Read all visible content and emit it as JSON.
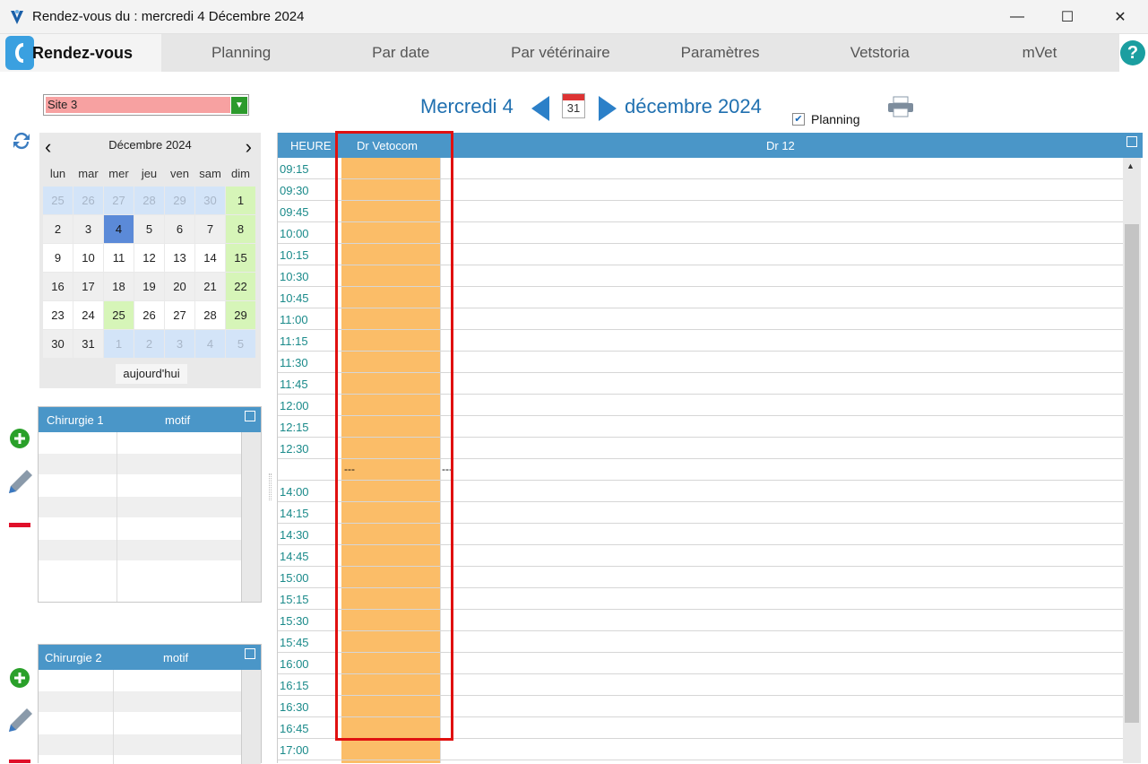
{
  "window": {
    "title": "Rendez-vous du : mercredi 4 Décembre 2024",
    "min": "—",
    "max": "☐",
    "close": "✕"
  },
  "tabs": {
    "active": "Rendez-vous",
    "items": [
      "Planning",
      "Par date",
      "Par vétérinaire",
      "Paramètres",
      "Vetstoria",
      "mVet"
    ]
  },
  "help": "?",
  "site": {
    "value": "Site 3"
  },
  "calendar": {
    "month": "Décembre 2024",
    "weekdays": [
      "lun",
      "mar",
      "mer",
      "jeu",
      "ven",
      "sam",
      "dim"
    ],
    "weeks": [
      [
        "25",
        "26",
        "27",
        "28",
        "29",
        "30",
        "1"
      ],
      [
        "2",
        "3",
        "4",
        "5",
        "6",
        "7",
        "8"
      ],
      [
        "9",
        "10",
        "11",
        "12",
        "13",
        "14",
        "15"
      ],
      [
        "16",
        "17",
        "18",
        "19",
        "20",
        "21",
        "22"
      ],
      [
        "23",
        "24",
        "25",
        "26",
        "27",
        "28",
        "29"
      ],
      [
        "30",
        "31",
        "1",
        "2",
        "3",
        "4",
        "5"
      ]
    ],
    "today_button": "aujourd'hui"
  },
  "panels": [
    {
      "title": "Chirurgie 1",
      "motif": "motif"
    },
    {
      "title": "Chirurgie 2",
      "motif": "motif"
    }
  ],
  "date_header": {
    "day": "Mercredi 4",
    "calendar_icon": "31",
    "month": "décembre 2024"
  },
  "planning_checkbox": {
    "label": "Planning",
    "checked": true
  },
  "grid": {
    "columns": [
      "HEURE",
      "Dr Vetocom",
      "Dr 12"
    ],
    "times": [
      "09:15",
      "09:30",
      "09:45",
      "10:00",
      "10:15",
      "10:30",
      "10:45",
      "11:00",
      "11:15",
      "11:30",
      "11:45",
      "12:00",
      "12:15",
      "12:30",
      "",
      "14:00",
      "14:15",
      "14:30",
      "14:45",
      "15:00",
      "15:15",
      "15:30",
      "15:45",
      "16:00",
      "16:15",
      "16:30",
      "16:45",
      "17:00"
    ],
    "lunch_marker": "---"
  },
  "colors": {
    "accent": "#4a96c8",
    "vet_column": "#fbbd68",
    "highlight": "#e01010"
  }
}
